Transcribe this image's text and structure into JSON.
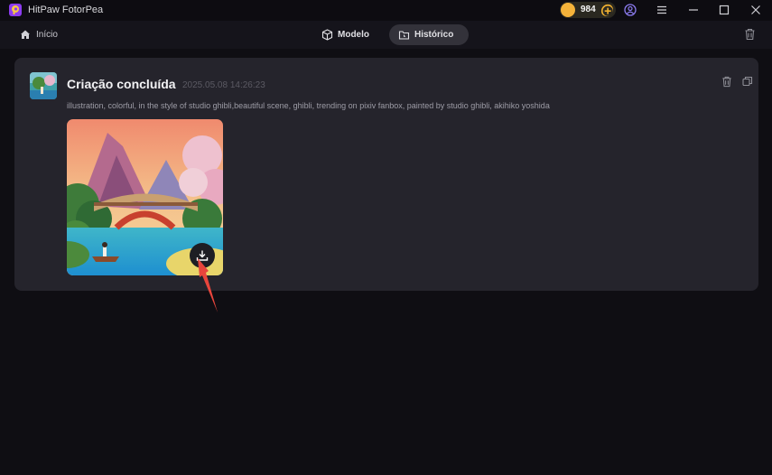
{
  "app": {
    "title": "HitPaw FotorPea"
  },
  "titlebar": {
    "coins": "984"
  },
  "nav": {
    "home_label": "Início",
    "tabs": [
      {
        "label": "Modelo",
        "active": false
      },
      {
        "label": "Histórico",
        "active": true
      }
    ]
  },
  "card": {
    "title": "Criação concluída",
    "timestamp": "2025.05.08 14:26:23",
    "prompt": "illustration, colorful, in the style of studio ghibli,beautiful scene, ghibli, trending on pixiv fanbox, painted by studio ghibli, akihiko yoshida"
  },
  "colors": {
    "accent_coin": "#f4b23a",
    "arrow": "#e8453c",
    "card_bg": "#25242c"
  }
}
